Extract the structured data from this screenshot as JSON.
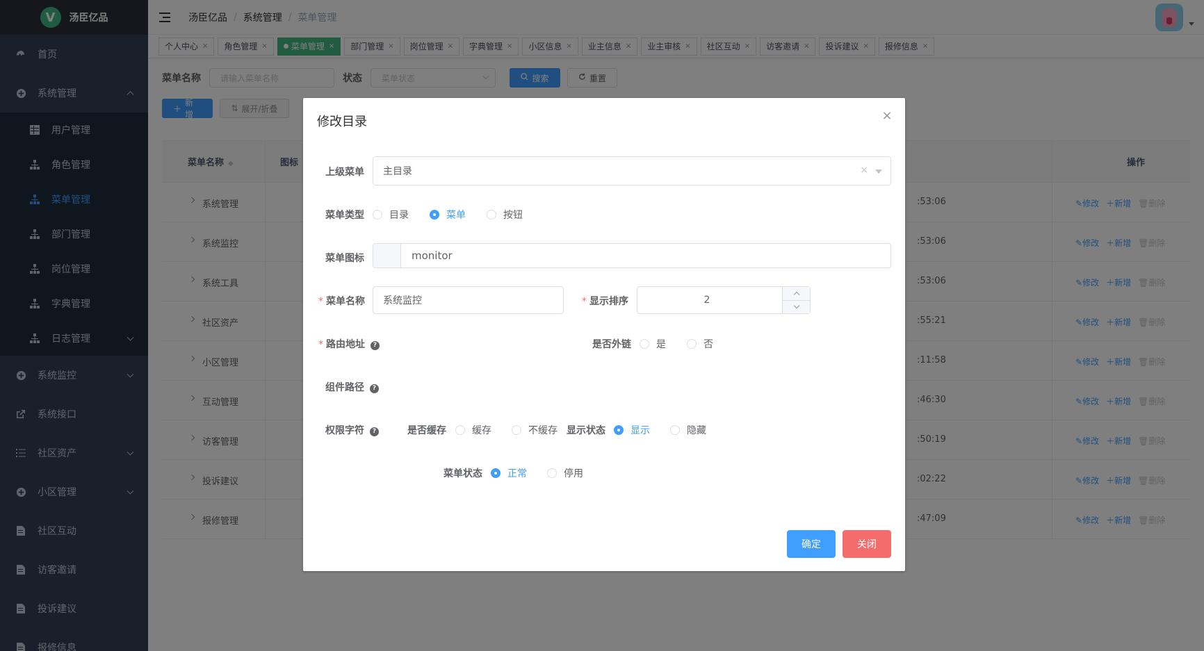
{
  "app": {
    "logo_letter": "V",
    "name": "汤臣亿品"
  },
  "sidebar": {
    "items": [
      {
        "label": "首页",
        "icon": "dashboard-icon"
      },
      {
        "label": "系统管理",
        "icon": "system-icon",
        "expanded": true
      },
      {
        "label": "系统监控",
        "icon": "monitor-icon"
      },
      {
        "label": "系统接口",
        "icon": "external-link-icon"
      },
      {
        "label": "社区资产",
        "icon": "list-icon"
      },
      {
        "label": "小区管理",
        "icon": "system-icon"
      },
      {
        "label": "社区互动",
        "icon": "document-icon"
      },
      {
        "label": "访客邀请",
        "icon": "document-icon"
      },
      {
        "label": "投诉建议",
        "icon": "document-icon"
      },
      {
        "label": "报修信息",
        "icon": "document-icon"
      }
    ],
    "sub_items": [
      {
        "label": "用户管理",
        "icon": "table-icon"
      },
      {
        "label": "角色管理",
        "icon": "tree-icon"
      },
      {
        "label": "菜单管理",
        "icon": "tree-icon",
        "active": true
      },
      {
        "label": "部门管理",
        "icon": "tree-icon"
      },
      {
        "label": "岗位管理",
        "icon": "tree-icon"
      },
      {
        "label": "字典管理",
        "icon": "tree-icon"
      },
      {
        "label": "日志管理",
        "icon": "tree-icon"
      }
    ]
  },
  "navbar": {
    "breadcrumb": [
      "汤臣亿品",
      "系统管理",
      "菜单管理"
    ]
  },
  "tags": [
    {
      "label": "个人中心"
    },
    {
      "label": "角色管理"
    },
    {
      "label": "菜单管理",
      "active": true
    },
    {
      "label": "部门管理"
    },
    {
      "label": "岗位管理"
    },
    {
      "label": "字典管理"
    },
    {
      "label": "小区信息"
    },
    {
      "label": "业主信息"
    },
    {
      "label": "业主审核"
    },
    {
      "label": "社区互动"
    },
    {
      "label": "访客邀请"
    },
    {
      "label": "投诉建议"
    },
    {
      "label": "报修信息"
    }
  ],
  "search": {
    "name_label": "菜单名称",
    "name_placeholder": "请输入菜单名称",
    "status_label": "状态",
    "status_placeholder": "菜单状态",
    "search_button": "搜索",
    "reset_button": "重置"
  },
  "actions": {
    "add_button": "新增",
    "toggle_button": "展开/折叠"
  },
  "table": {
    "columns": {
      "name": "菜单名称",
      "icon": "图标",
      "op": "操作"
    },
    "rows": [
      {
        "name": "系统管理",
        "time": ":53:06"
      },
      {
        "name": "系统监控",
        "time": ":53:06"
      },
      {
        "name": "系统工具",
        "time": ":53:06"
      },
      {
        "name": "社区资产",
        "time": ":55:21"
      },
      {
        "name": "小区管理",
        "time": ":11:58"
      },
      {
        "name": "互动管理",
        "time": ":46:30"
      },
      {
        "name": "访客管理",
        "time": ":50:19"
      },
      {
        "name": "投诉建议",
        "time": ":02:22"
      },
      {
        "name": "报修管理",
        "time": ":47:09"
      }
    ],
    "op_edit": "修改",
    "op_add": "新增",
    "op_delete": "删除"
  },
  "dialog": {
    "title": "修改目录",
    "parent_label": "上级菜单",
    "parent_value": "主目录",
    "type_label": "菜单类型",
    "type_options": [
      "目录",
      "菜单",
      "按钮"
    ],
    "type_selected": "菜单",
    "icon_label": "菜单图标",
    "icon_value": "monitor",
    "name_label": "菜单名称",
    "name_value": "系统监控",
    "order_label": "显示排序",
    "order_value": "2",
    "route_label": "路由地址",
    "external_label": "是否外链",
    "external_options": [
      "是",
      "否"
    ],
    "component_label": "组件路径",
    "perm_label": "权限字符",
    "cache_label": "是否缓存",
    "cache_options": [
      "缓存",
      "不缓存"
    ],
    "visible_label": "显示状态",
    "visible_options": [
      "显示",
      "隐藏"
    ],
    "visible_selected": "显示",
    "status_label": "菜单状态",
    "status_options": [
      "正常",
      "停用"
    ],
    "status_selected": "正常",
    "confirm_button": "确定",
    "close_button": "关闭"
  },
  "colors": {
    "primary": "#409eff",
    "success_tag": "#42b983",
    "danger": "#f56c6c",
    "sidebar_bg": "#304156"
  }
}
